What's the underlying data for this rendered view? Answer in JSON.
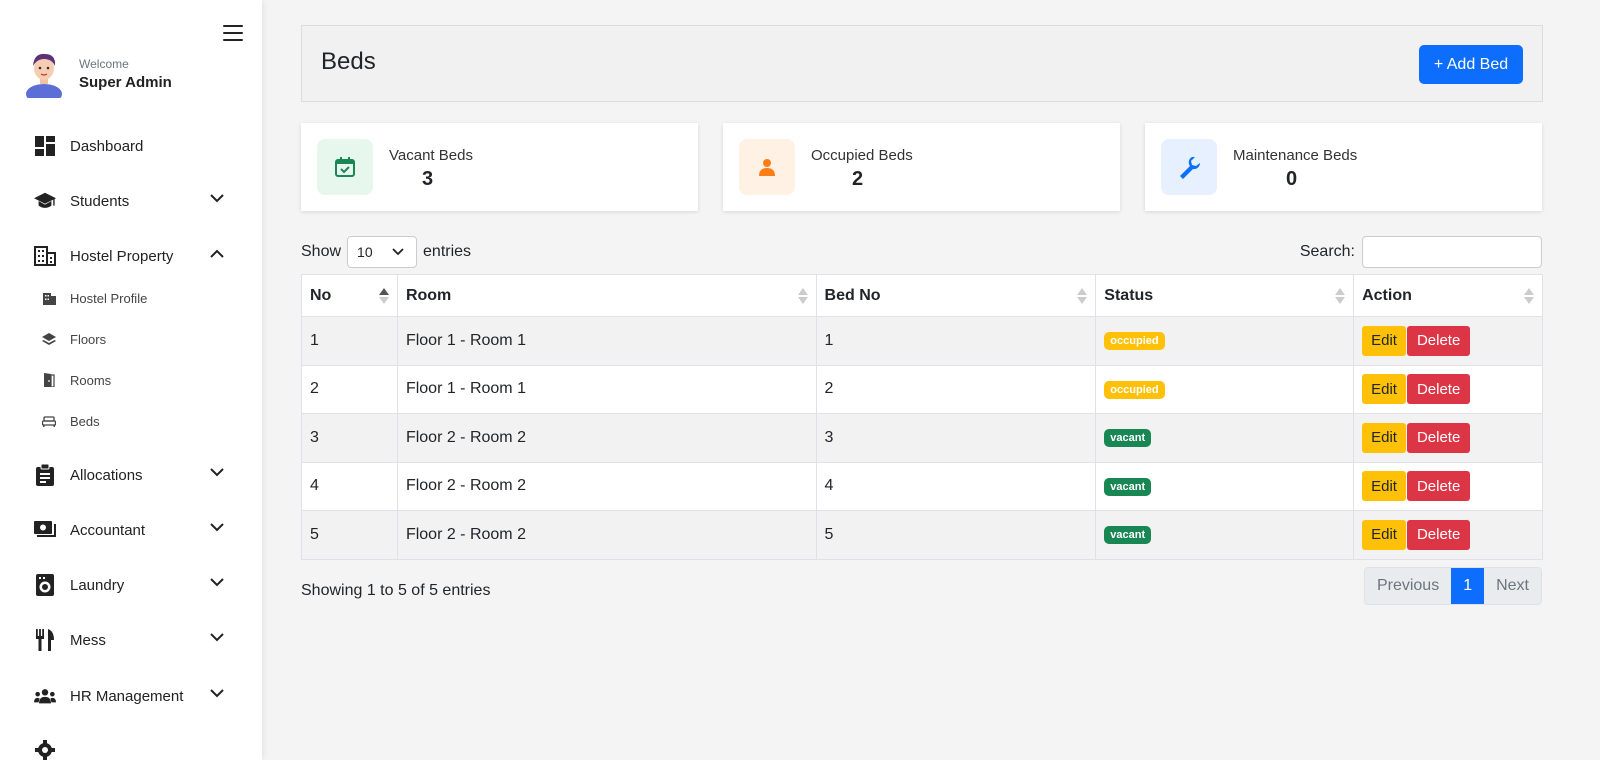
{
  "sidebar": {
    "welcome": "Welcome",
    "user_name": "Super Admin",
    "items": [
      {
        "label": "Dashboard",
        "icon": "dashboard-icon"
      },
      {
        "label": "Students",
        "icon": "graduation-cap-icon"
      },
      {
        "label": "Hostel Property",
        "icon": "building-icon"
      },
      {
        "label": "Allocations",
        "icon": "clipboard-icon"
      },
      {
        "label": "Accountant",
        "icon": "money-icon"
      },
      {
        "label": "Laundry",
        "icon": "washing-machine-icon"
      },
      {
        "label": "Mess",
        "icon": "utensils-icon"
      },
      {
        "label": "HR Management",
        "icon": "users-icon"
      }
    ],
    "subitems": [
      {
        "label": "Hostel Profile",
        "icon": "building-small-icon"
      },
      {
        "label": "Floors",
        "icon": "layers-icon"
      },
      {
        "label": "Rooms",
        "icon": "door-icon"
      },
      {
        "label": "Beds",
        "icon": "bed-icon"
      }
    ]
  },
  "header": {
    "title": "Beds",
    "add_button": "+ Add Bed"
  },
  "stats": [
    {
      "label": "Vacant Beds",
      "value": "3",
      "icon": "calendar-check-icon",
      "color": "#198754",
      "bg": "#e8f7ee"
    },
    {
      "label": "Occupied Beds",
      "value": "2",
      "icon": "user-icon",
      "color": "#fd7e14",
      "bg": "#fff1e3"
    },
    {
      "label": "Maintenance Beds",
      "value": "0",
      "icon": "wrench-icon",
      "color": "#0d6efd",
      "bg": "#e7f0ff"
    }
  ],
  "table_controls": {
    "show": "Show",
    "entries": "entries",
    "length_value": "10",
    "search_label": "Search:",
    "search_value": ""
  },
  "table": {
    "headers": [
      "No",
      "Room",
      "Bed No",
      "Status",
      "Action"
    ],
    "rows": [
      {
        "no": "1",
        "room": "Floor 1 - Room 1",
        "bed": "1",
        "status": "occupied"
      },
      {
        "no": "2",
        "room": "Floor 1 - Room 1",
        "bed": "2",
        "status": "occupied"
      },
      {
        "no": "3",
        "room": "Floor 2 - Room 2",
        "bed": "3",
        "status": "vacant"
      },
      {
        "no": "4",
        "room": "Floor 2 - Room 2",
        "bed": "4",
        "status": "vacant"
      },
      {
        "no": "5",
        "room": "Floor 2 - Room 2",
        "bed": "5",
        "status": "vacant"
      }
    ],
    "edit_label": "Edit",
    "delete_label": "Delete"
  },
  "footer": {
    "info": "Showing 1 to 5 of 5 entries",
    "previous": "Previous",
    "page": "1",
    "next": "Next"
  }
}
